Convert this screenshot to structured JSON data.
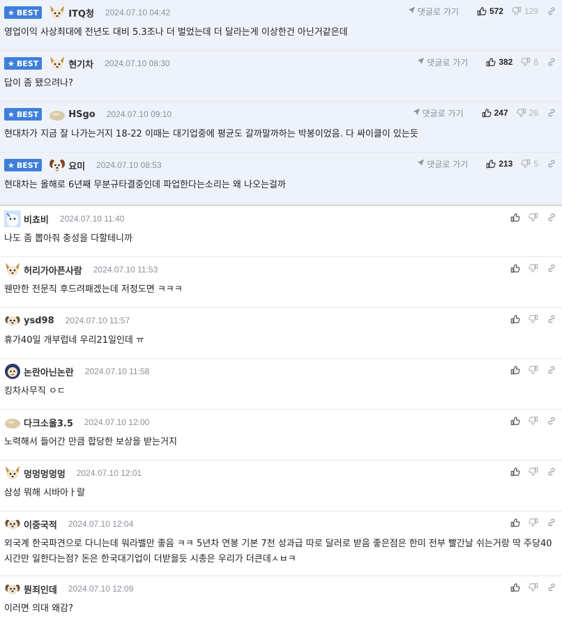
{
  "colors": {
    "best_bg": "#eef3fb",
    "badge": "#3f7fdb",
    "muted": "#8a8f98"
  },
  "ui": {
    "best_label": "BEST",
    "reply_label": "댓글로 가기"
  },
  "best_comments": [
    {
      "avatar": "fox",
      "nick": "ITQ청",
      "date": "2024.07.10 04:42",
      "text": "영업이익 사상최대에 전년도 대비 5.3조나 더 벌었는데 더 달라는게 이상한건 아닌거같은데",
      "up": "572",
      "down": "129"
    },
    {
      "avatar": "fox",
      "nick": "현기차",
      "date": "2024.07.10 08:30",
      "text": "답이 좀 됐으려나?",
      "up": "382",
      "down": "6"
    },
    {
      "avatar": "blob",
      "nick": "HSgo",
      "date": "2024.07.10 09:10",
      "text": "현대차가 지금 잘 나가는거지 18-22 이때는 대기업중에 평균도 갈까말까하는 박봉이었음. 다 싸이클이 있는듯",
      "up": "247",
      "down": "26"
    },
    {
      "avatar": "dog",
      "nick": "요미",
      "date": "2024.07.10 08:53",
      "text": "현대차는 올해로 6년째 무분규타결중인데 파업한다는소리는 왜 나오는걸까",
      "up": "213",
      "down": "5"
    }
  ],
  "comments": [
    {
      "avatar": "blue",
      "nick": "비쵸비",
      "date": "2024.07.10 11:40",
      "text": "나도 좀 뽑아줘 충성을 다할테니까"
    },
    {
      "avatar": "fox",
      "nick": "허리가아픈사람",
      "date": "2024.07.10 11:53",
      "text": "웬만한 전문직 후드려패겠는데 저정도면 ㅋㅋㅋ"
    },
    {
      "avatar": "pup",
      "nick": "ysd98",
      "date": "2024.07.10 11:57",
      "text": "휴가40일 개부럽네 우리21일인데 ㅠ"
    },
    {
      "avatar": "lion",
      "nick": "논란아닌논란",
      "date": "2024.07.10 11:58",
      "text": "킹차사무직 ㅇㄷ"
    },
    {
      "avatar": "blob",
      "nick": "다크소울3.5",
      "date": "2024.07.10 12:00",
      "text": "노력해서 들어간 만큼 합당한 보상을 받는거지"
    },
    {
      "avatar": "fox",
      "nick": "멍멍멍멍멍",
      "date": "2024.07.10 12:01",
      "text": "삼성 뭐해 시바아ㅏ랄"
    },
    {
      "avatar": "pup",
      "nick": "이중국적",
      "date": "2024.07.10 12:04",
      "text": "외국계 한국파견으로 다니는데 워라벨만 좋음 ㅋㅋ 5년차 연봉 기본 7천 성과급 따로 달러로 받음 좋은점은 한미 전부 빨간날 쉬는거랑 딱 주당40시간만 일한다는점? 돈은 한국대기업이 더받을듯 시총은 우리가 더큰데ㅅㅂㅋ"
    },
    {
      "avatar": "pup",
      "nick": "뭔죄인데",
      "date": "2024.07.10 12:09",
      "text": "이러면 의대 왜감?"
    }
  ]
}
